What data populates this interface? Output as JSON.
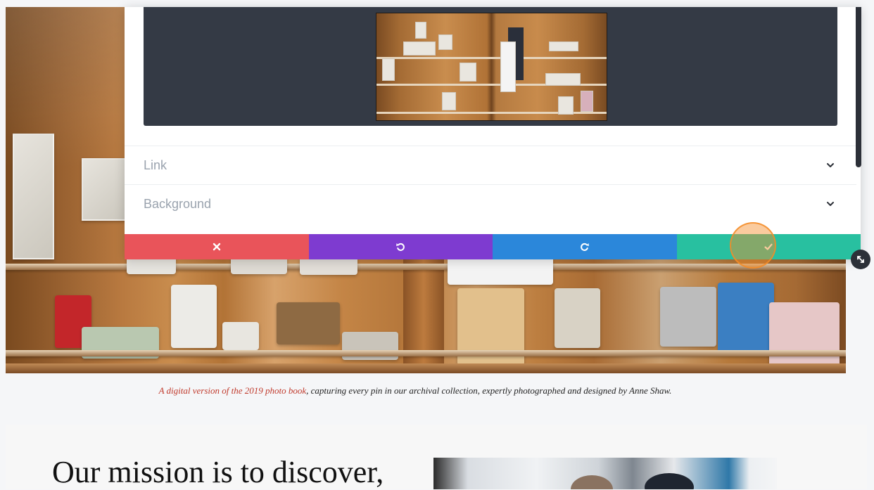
{
  "editor": {
    "sections": [
      {
        "label": "Link"
      },
      {
        "label": "Background"
      }
    ],
    "toolbar": {
      "cancel": "cancel",
      "undo": "undo",
      "redo": "redo",
      "save": "save"
    },
    "colors": {
      "cancel": "#e9545a",
      "undo": "#7e3bd0",
      "redo": "#2b87da",
      "save": "#28c0a0",
      "preview_bg": "#343a45"
    }
  },
  "caption": {
    "link_text": "A digital version of the 2019 photo book",
    "rest_text": ", capturing every pin in our archival collection, expertly photographed and designed by Anne Shaw."
  },
  "mission": {
    "heading": "Our mission is to discover,"
  }
}
